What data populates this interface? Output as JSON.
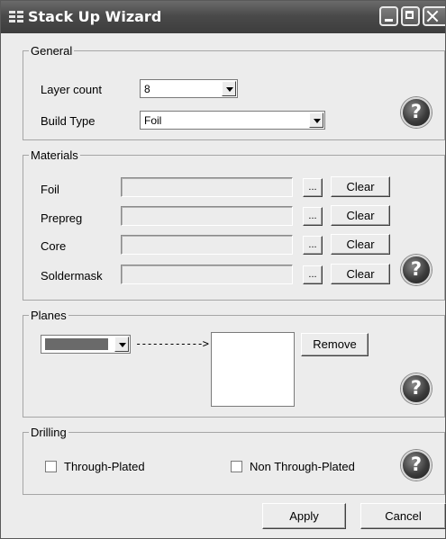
{
  "window": {
    "title": "Stack Up Wizard",
    "icon": "wizard-app-icon"
  },
  "general": {
    "legend": "General",
    "layer_count_label": "Layer count",
    "layer_count_value": "8",
    "build_type_label": "Build Type",
    "build_type_value": "Foil"
  },
  "materials": {
    "legend": "Materials",
    "rows": [
      {
        "label": "Foil",
        "browse": "...",
        "clear": "Clear"
      },
      {
        "label": "Prepreg",
        "browse": "...",
        "clear": "Clear"
      },
      {
        "label": "Core",
        "browse": "...",
        "clear": "Clear"
      },
      {
        "label": "Soldermask",
        "browse": "...",
        "clear": "Clear"
      }
    ]
  },
  "planes": {
    "legend": "Planes",
    "arrow": "------------>",
    "remove_label": "Remove",
    "swatch_color": "#6a6a6a"
  },
  "drilling": {
    "legend": "Drilling",
    "through_plated_label": "Through-Plated",
    "non_through_plated_label": "Non Through-Plated"
  },
  "footer": {
    "apply_label": "Apply",
    "cancel_label": "Cancel"
  },
  "help": {
    "glyph": "?"
  },
  "colors": {
    "titlebar": "#4a4a4a",
    "dialog": "#ececec",
    "group_border": "#a6a6a6"
  }
}
